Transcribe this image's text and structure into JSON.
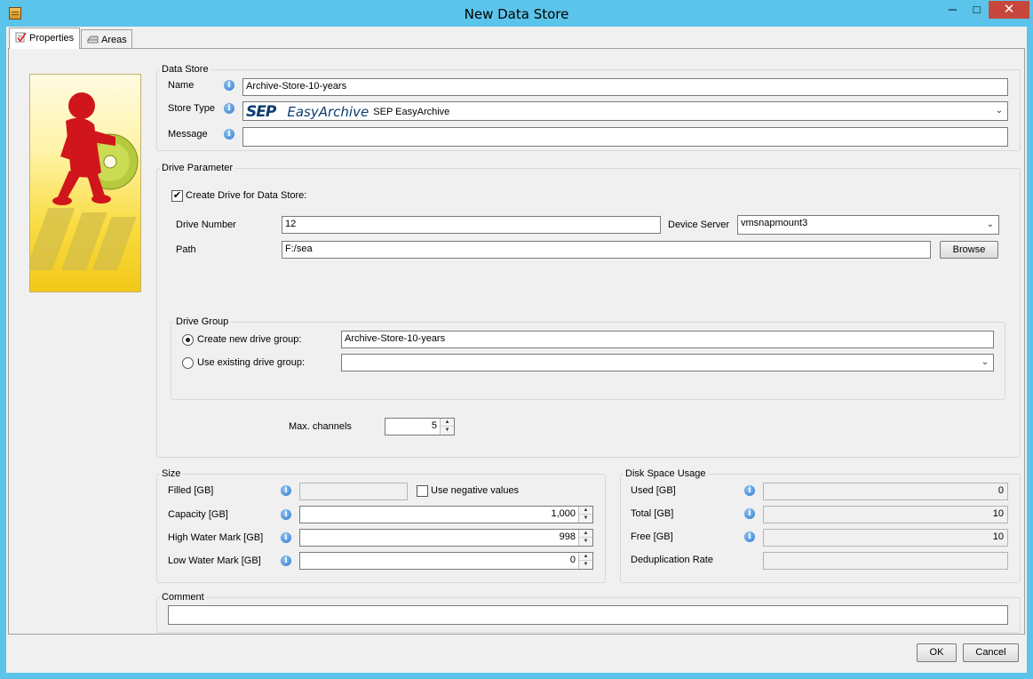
{
  "window": {
    "title": "New Data Store",
    "min_glyph": "─",
    "max_glyph": "□",
    "close_glyph": "✕"
  },
  "tabs": [
    {
      "label": "Properties",
      "icon": "properties-icon",
      "active": true
    },
    {
      "label": "Areas",
      "icon": "disk-icon",
      "active": false
    }
  ],
  "data_store": {
    "legend": "Data Store",
    "name_label": "Name",
    "name_value": "Archive-Store-10-years",
    "store_type_label": "Store Type",
    "store_type_logo_text": "SEP",
    "store_type_logo_product": "EasyArchive",
    "store_type_value": "SEP EasyArchive",
    "message_label": "Message",
    "message_value": ""
  },
  "drive_parameter": {
    "legend": "Drive Parameter",
    "create_drive_label": "Create Drive for Data Store:",
    "create_drive_checked": true,
    "drive_number_label": "Drive Number",
    "drive_number_value": "12",
    "device_server_label": "Device Server",
    "device_server_value": "vmsnapmount3",
    "path_label": "Path",
    "path_value": "F:/sea",
    "browse_label": "Browse",
    "drive_group": {
      "legend": "Drive Group",
      "create_new_label": "Create new drive group:",
      "create_new_value": "Archive-Store-10-years",
      "use_existing_label": "Use existing drive group:",
      "use_existing_value": "",
      "selected": "create_new"
    },
    "max_channels_label": "Max. channels",
    "max_channels_value": "5"
  },
  "size": {
    "legend": "Size",
    "filled_label": "Filled [GB]",
    "filled_value": "",
    "use_negative_label": "Use negative values",
    "use_negative_checked": false,
    "capacity_label": "Capacity [GB]",
    "capacity_value": "1,000",
    "high_water_label": "High Water Mark [GB]",
    "high_water_value": "998",
    "low_water_label": "Low Water Mark [GB]",
    "low_water_value": "0"
  },
  "disk_usage": {
    "legend": "Disk Space Usage",
    "used_label": "Used [GB]",
    "used_value": "0",
    "total_label": "Total [GB]",
    "total_value": "10",
    "free_label": "Free [GB]",
    "free_value": "10",
    "dedup_label": "Deduplication Rate",
    "dedup_value": ""
  },
  "comment": {
    "legend": "Comment",
    "value": ""
  },
  "footer": {
    "ok_label": "OK",
    "cancel_label": "Cancel"
  },
  "icons": {
    "info": "info-icon",
    "combo": "chevron-down-icon",
    "spin_up": "spin-up-icon",
    "spin_down": "spin-down-icon",
    "info_glyph": "i",
    "combo_glyph": "⌄",
    "spin_up_glyph": "▲",
    "spin_down_glyph": "▼",
    "check_glyph": "✔"
  },
  "colors": {
    "titlebar": "#5bc4ea",
    "close_button": "#c7473c",
    "logo_blue": "#0d3a70",
    "mascot_red": "#d0161c"
  }
}
